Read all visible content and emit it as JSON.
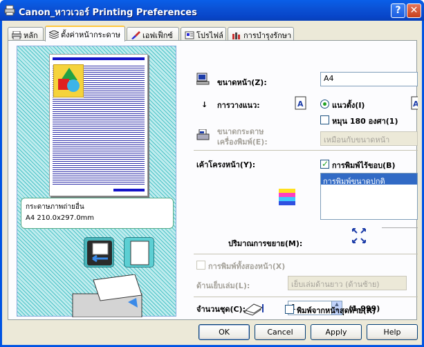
{
  "window": {
    "title": "Canon_หาวเวอร์ Printing Preferences",
    "help_btn": "?",
    "close_btn": "✕"
  },
  "tabs": [
    {
      "label": "หลัก",
      "icon": "printer-icon"
    },
    {
      "label": "ตั้งค่าหน้ากระดาษ",
      "icon": "layers-icon",
      "active": true
    },
    {
      "label": "เอฟเฟ็กซ์",
      "icon": "brush-icon"
    },
    {
      "label": "โปรไฟล์",
      "icon": "profile-icon"
    },
    {
      "label": "การบำรุงรักษา",
      "icon": "tools-icon"
    }
  ],
  "preview": {
    "paper_line1": "กระดาษภาพถ่ายอื่น",
    "paper_line2": "A4 210.0x297.0mm"
  },
  "page_size": {
    "label": "ขนาดหน้า(Z):",
    "value": "A4"
  },
  "orientation": {
    "label": "การวางแนว:",
    "portrait_label": "แนวตั้ง(I)",
    "rotate_label": "หมุน 180 องศา(1)"
  },
  "printer_paper": {
    "label_line1": "ขนาดกระดาษ",
    "label_line2": "เครื่องพิมพ์(E):",
    "value": "เหมือนกับขนาดหน้า"
  },
  "layout": {
    "label": "เค้าโครงหน้า(Y):",
    "borderless_label": "การพิมพ์ไร้ขอบ(B)",
    "list_selected": "การพิมพ์ขนาดปกติ"
  },
  "magnification": {
    "label": "ปริมาณการขยาย(M):"
  },
  "duplex": {
    "label": "การพิมพ์ทั้งสองหน้า(X)",
    "stapling_label": "ด้านเย็บเล่ม(L):",
    "stapling_value": "เย็บเล่มด้านยาว (ด้านซ้าย)"
  },
  "copies": {
    "label": "จำนวนชุด(C):",
    "value": "1",
    "range": "(1-999)",
    "reverse_label": "พิมพ์จากหน้าสุดท้าย(R)"
  },
  "buttons": {
    "ok": "OK",
    "cancel": "Cancel",
    "apply": "Apply",
    "help": "Help"
  },
  "colors": {
    "title_blue": "#0054e3",
    "check_green": "#21a121",
    "selection_blue": "#316ac5"
  }
}
